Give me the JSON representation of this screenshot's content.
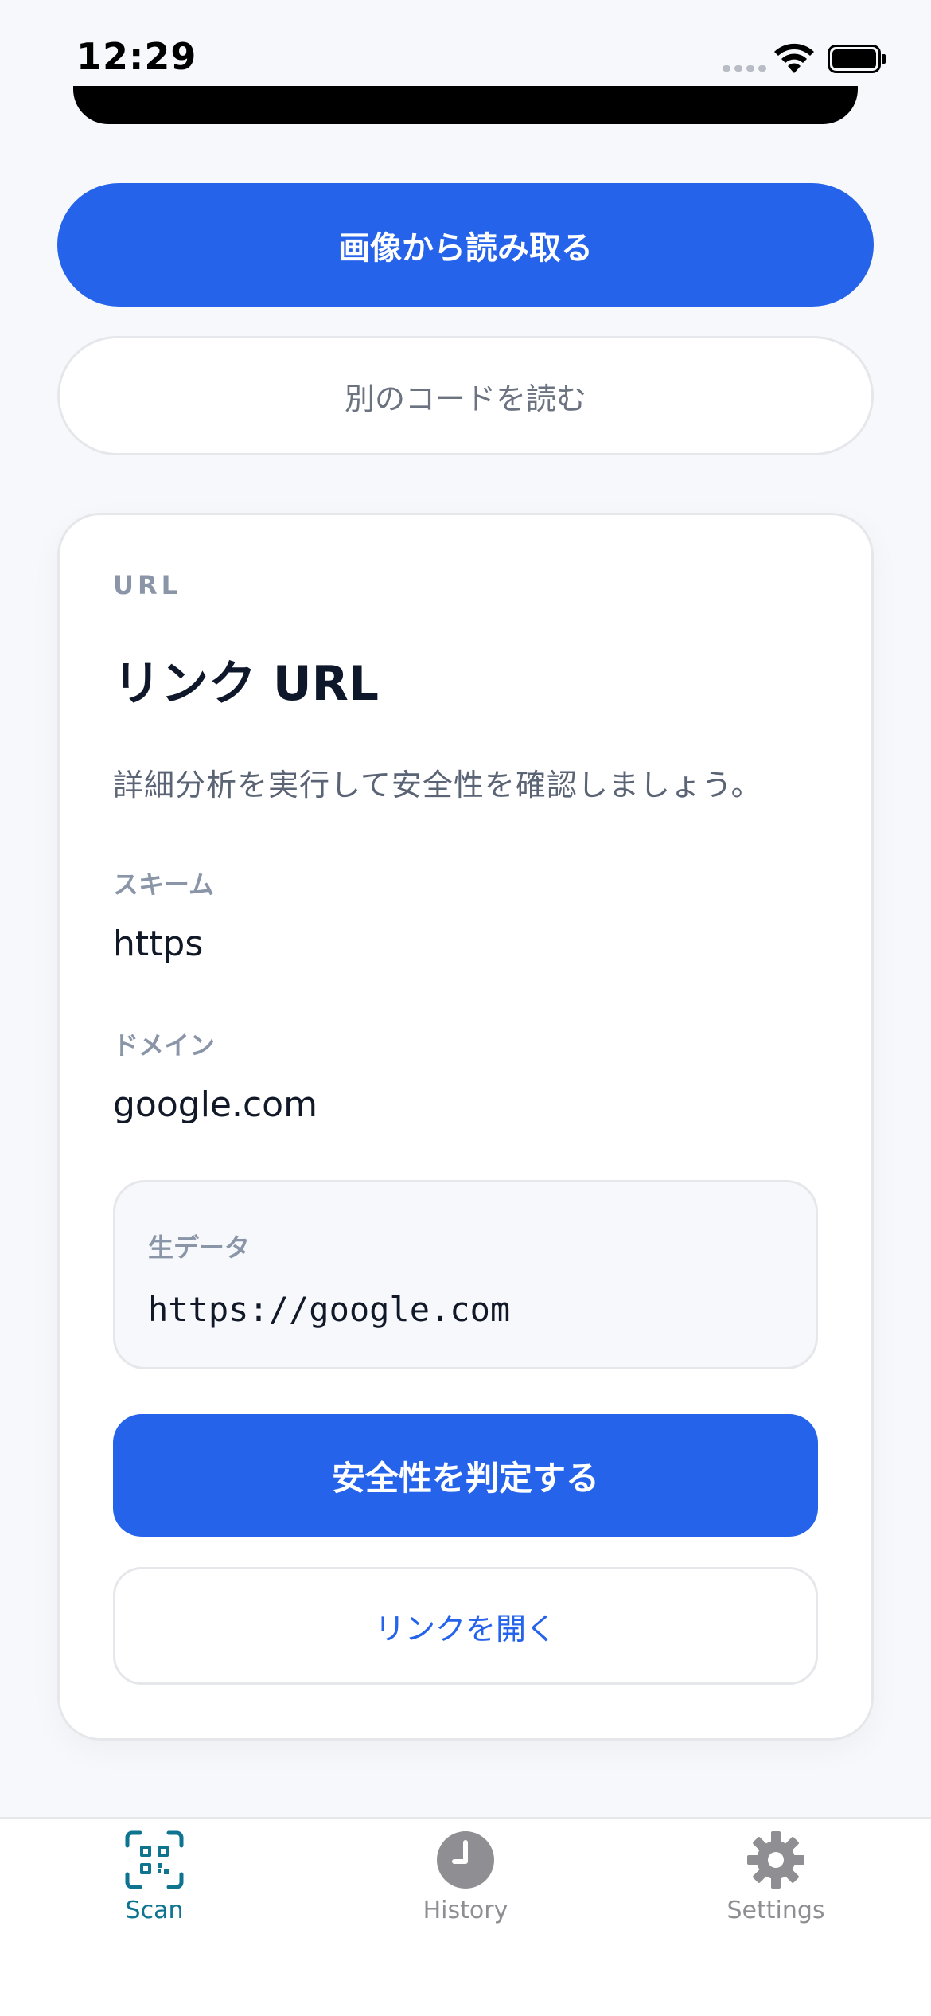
{
  "status_bar": {
    "time": "12:29"
  },
  "actions": {
    "read_from_image": "画像から読み取る",
    "scan_another": "別のコードを読む"
  },
  "result": {
    "type_label": "URL",
    "title": "リンク URL",
    "description": "詳細分析を実行して安全性を確認しましょう。",
    "fields": [
      {
        "label": "スキーム",
        "value": "https"
      },
      {
        "label": "ドメイン",
        "value": "google.com"
      }
    ],
    "raw": {
      "label": "生データ",
      "value": "https://google.com"
    },
    "check_safety_button": "安全性を判定する",
    "open_link_button": "リンクを開く"
  },
  "tab_bar": {
    "tabs": [
      {
        "label": "Scan",
        "icon": "qr-scan-icon",
        "active": true
      },
      {
        "label": "History",
        "icon": "clock-icon",
        "active": false
      },
      {
        "label": "Settings",
        "icon": "gear-icon",
        "active": false
      }
    ]
  },
  "colors": {
    "accent": "#2563eb",
    "active_tab": "#0e7490",
    "inactive_tab": "#8e8e93",
    "background": "#f6f8fb"
  }
}
